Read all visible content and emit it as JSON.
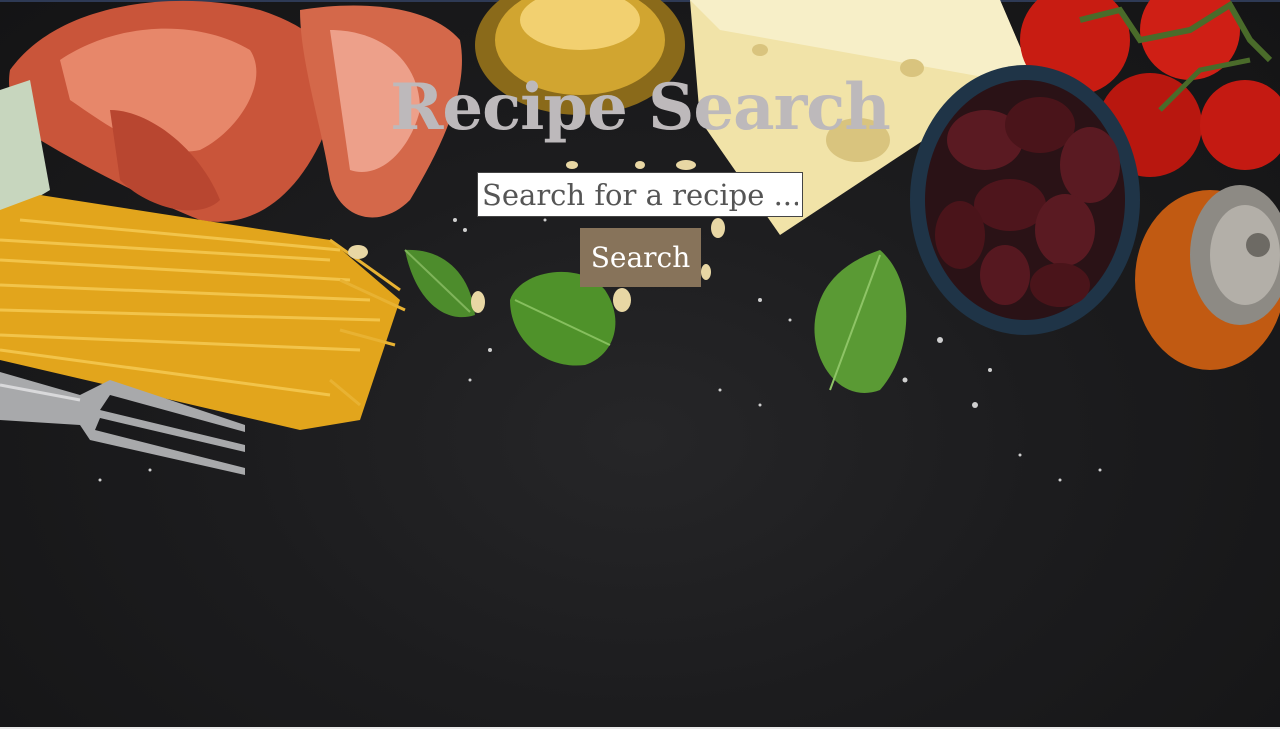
{
  "header": {
    "title": "Recipe Search"
  },
  "search": {
    "placeholder": "Search for a recipe ...",
    "value": "",
    "button_label": "Search"
  },
  "background": {
    "description_items": [
      "prosciutto",
      "olive-oil",
      "cheese",
      "tomatoes",
      "spaghetti",
      "basil-leaves",
      "olives-bowl",
      "pepper-mill",
      "fork",
      "pine-nuts",
      "salt"
    ]
  },
  "colors": {
    "title": "#bdb9bb",
    "button": "#87735a",
    "background": "#1c1c1e"
  }
}
